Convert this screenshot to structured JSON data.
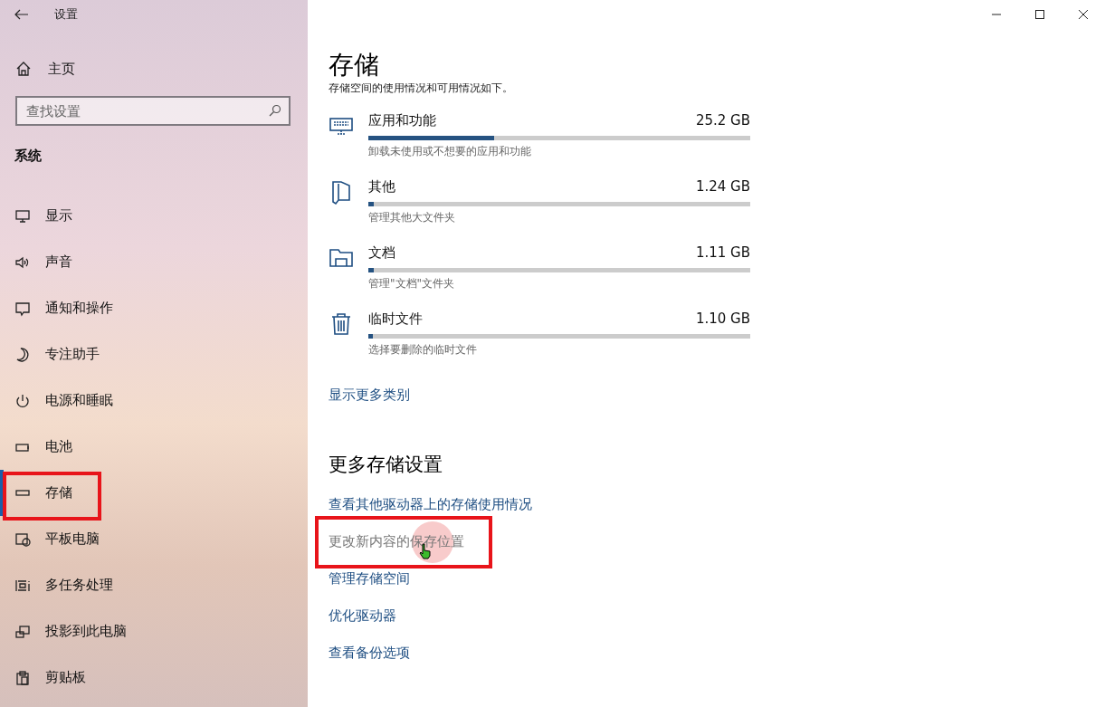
{
  "window": {
    "title": "设置"
  },
  "sidebar": {
    "home": "主页",
    "search": {
      "placeholder": "查找设置"
    },
    "section": "系统",
    "items": [
      {
        "label": "显示",
        "selected": false,
        "highlighted": false
      },
      {
        "label": "声音",
        "selected": false,
        "highlighted": false
      },
      {
        "label": "通知和操作",
        "selected": false,
        "highlighted": false
      },
      {
        "label": "专注助手",
        "selected": false,
        "highlighted": false
      },
      {
        "label": "电源和睡眠",
        "selected": false,
        "highlighted": false
      },
      {
        "label": "电池",
        "selected": false,
        "highlighted": false
      },
      {
        "label": "存储",
        "selected": true,
        "highlighted": true
      },
      {
        "label": "平板电脑",
        "selected": false,
        "highlighted": false
      },
      {
        "label": "多任务处理",
        "selected": false,
        "highlighted": false
      },
      {
        "label": "投影到此电脑",
        "selected": false,
        "highlighted": false
      },
      {
        "label": "剪贴板",
        "selected": false,
        "highlighted": false
      }
    ]
  },
  "page": {
    "title": "存储",
    "description": "存储空间的使用情况和可用情况如下。",
    "categories": [
      {
        "name": "应用和功能",
        "size": "25.2 GB",
        "level": 0.33,
        "hint": "卸载未使用或不想要的应用和功能"
      },
      {
        "name": "其他",
        "size": "1.24 GB",
        "level": 0.015,
        "hint": "管理其他大文件夹"
      },
      {
        "name": "文档",
        "size": "1.11 GB",
        "level": 0.014,
        "hint": "管理\"文档\"文件夹"
      },
      {
        "name": "临时文件",
        "size": "1.10 GB",
        "level": 0.013,
        "hint": "选择要删除的临时文件"
      }
    ],
    "more_link": "显示更多类别",
    "more_settings": {
      "title": "更多存储设置",
      "links": [
        {
          "label": "查看其他驱动器上的存储使用情况",
          "hovered": false,
          "highlighted": false
        },
        {
          "label": "更改新内容的保存位置",
          "hovered": true,
          "highlighted": true
        },
        {
          "label": "管理存储空间",
          "hovered": false,
          "highlighted": false
        },
        {
          "label": "优化驱动器",
          "hovered": false,
          "highlighted": false
        },
        {
          "label": "查看备份选项",
          "hovered": false,
          "highlighted": false
        }
      ]
    }
  }
}
